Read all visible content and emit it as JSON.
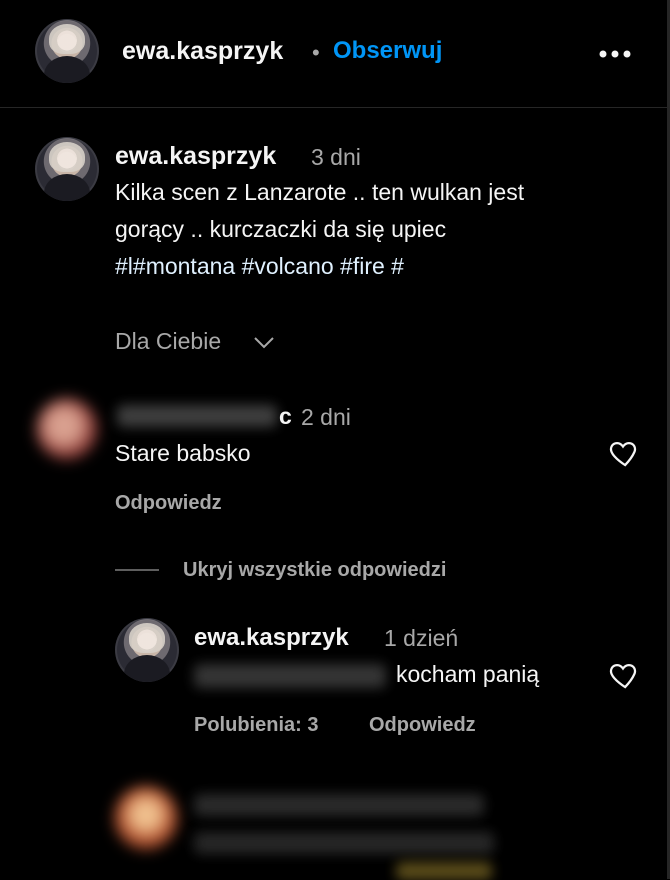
{
  "header": {
    "username": "ewa.kasprzyk",
    "separator": "•",
    "follow_label": "Obserwuj",
    "more_label": "•••"
  },
  "caption": {
    "username": "ewa.kasprzyk",
    "time": "3 dni",
    "line1": "Kilka scen z Lanzarote .. ten wulkan jest",
    "line2": "gorący .. kurczaczki da się upiec",
    "hashtags": "#l#montana #volcano #fire #"
  },
  "sort": {
    "label": "Dla Ciebie"
  },
  "comment1": {
    "username_tail": "c",
    "time": "2 dni",
    "text": "Stare babsko",
    "reply_label": "Odpowiedz",
    "hide_replies_label": "Ukryj wszystkie odpowiedzi"
  },
  "reply1": {
    "username": "ewa.kasprzyk",
    "time": "1 dzień",
    "text": "kocham panią",
    "likes_label": "Polubienia: 3",
    "reply_label": "Odpowiedz"
  },
  "colors": {
    "background": "#000000",
    "text": "#f5f5f5",
    "muted": "#a8a8a8",
    "accent": "#0095f6",
    "divider": "#262626"
  },
  "icons": {
    "more": "more-icon",
    "chevron": "chevron-down-icon",
    "heart": "heart-icon"
  }
}
